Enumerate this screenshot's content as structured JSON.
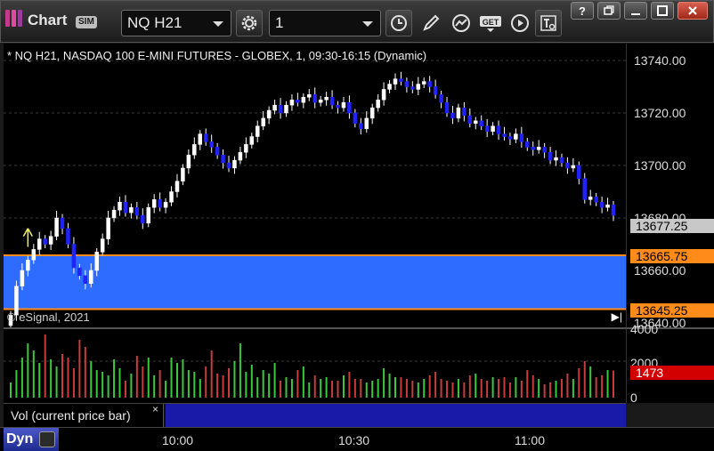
{
  "window": {
    "title": "Chart",
    "badge": "SIM",
    "symbol": "NQ H21",
    "interval": "1",
    "toolbar_icons": [
      "settings-gear-icon",
      "clock-icon",
      "pencil-draw-icon",
      "studies-icon",
      "get-data-icon",
      "play-icon",
      "template-icon"
    ],
    "window_icons": [
      "help-icon",
      "restore-icon",
      "maximize-icon",
      "close-icon"
    ]
  },
  "plot": {
    "title": "* NQ H21, NASDAQ 100 E-MINI FUTURES - GLOBEX, 1, 09:30-16:15 (Dynamic)",
    "copyright": "© eSignal, 2021"
  },
  "price_axis": {
    "labels": [
      "13740.00",
      "13720.00",
      "13700.00",
      "13680.00",
      "13660.00",
      "13640.00"
    ],
    "tags": [
      {
        "text": "13677.25",
        "color": "#c8c8c8",
        "text_color": "#000000"
      },
      {
        "text": "13665.75",
        "color": "#ff8c1a",
        "text_color": "#000000"
      },
      {
        "text": "13645.25",
        "color": "#ff8c1a",
        "text_color": "#000000"
      }
    ]
  },
  "zone": {
    "upper": 13665.75,
    "lower": 13645.25,
    "fill": "#2e6cff",
    "border": "#ff8c1a"
  },
  "vol_axis": {
    "labels": [
      "4000",
      "2000",
      "0"
    ],
    "tag": {
      "text": "1473",
      "color": "#d20000",
      "text_color": "#ffffff"
    }
  },
  "study": {
    "label": "Vol (current price bar)",
    "close": "×"
  },
  "time_axis": {
    "mode": "Dyn",
    "labels": [
      "10:00",
      "10:30",
      "11:00"
    ]
  },
  "chart_data": {
    "type": "candlestick",
    "interval_minutes": 1,
    "time_labels": [
      "10:00",
      "10:30",
      "11:00"
    ],
    "ylim": [
      13640,
      13745
    ],
    "close": [
      13643,
      13654,
      13660,
      13664,
      13668,
      13672,
      13670,
      13673,
      13680,
      13676,
      13670,
      13661,
      13658,
      13655,
      13660,
      13667,
      13672,
      13680,
      13683,
      13686,
      13682,
      13684,
      13681,
      13678,
      13684,
      13687,
      13684,
      13686,
      13690,
      13694,
      13699,
      13704,
      13708,
      13712,
      13709,
      13707,
      13704,
      13701,
      13699,
      13702,
      13705,
      13708,
      13711,
      13715,
      13718,
      13721,
      13723,
      13720,
      13723,
      13725,
      13724,
      13726,
      13727,
      13724,
      13725,
      13726,
      13723,
      13722,
      13724,
      13720,
      13716,
      13714,
      13718,
      13722,
      13725,
      13729,
      13731,
      13733,
      13732,
      13730,
      13729,
      13731,
      13732,
      13730,
      13727,
      13724,
      13720,
      13718,
      13722,
      13719,
      13716,
      13717,
      13715,
      13713,
      13715,
      13712,
      13711,
      13710,
      13712,
      13709,
      13707,
      13706,
      13707,
      13705,
      13702,
      13703,
      13701,
      13699,
      13700,
      13695,
      13687,
      13688,
      13686,
      13684,
      13685,
      13681
    ],
    "volume": [
      800,
      1500,
      2200,
      3000,
      2600,
      1900,
      3500,
      2100,
      1700,
      2400,
      2200,
      1600,
      3200,
      2800,
      2000,
      1500,
      1400,
      1200,
      2100,
      1600,
      900,
      1300,
      2300,
      1700,
      2200,
      1200,
      1500,
      900,
      2200,
      1900,
      2100,
      1500,
      1400,
      1000,
      1700,
      2600,
      1300,
      1200,
      1600,
      2000,
      3000,
      1400,
      1800,
      1100,
      1500,
      1300,
      1900,
      900,
      1100,
      1000,
      1500,
      1700,
      800,
      1200,
      1000,
      1100,
      900,
      900,
      1200,
      1400,
      1000,
      1000,
      800,
      900,
      1000,
      1600,
      1300,
      1100,
      1100,
      1000,
      900,
      800,
      1000,
      1200,
      1400,
      1000,
      900,
      800,
      1000,
      800,
      1200,
      1300,
      1000,
      900,
      1100,
      1000,
      1100,
      800,
      1100,
      900,
      1500,
      1200,
      1000,
      700,
      800,
      900,
      1000,
      1300,
      1000,
      1600,
      2000,
      1700,
      1100,
      1200,
      1500,
      1473
    ]
  }
}
